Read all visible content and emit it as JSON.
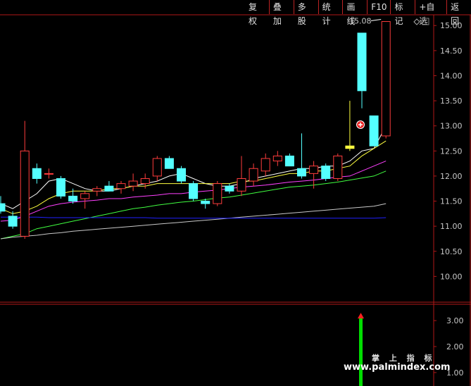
{
  "toolbar": {
    "buttons": [
      "复权",
      "叠加",
      "多股",
      "统计",
      "画线",
      "F10",
      "标记",
      "+自选",
      "返回"
    ]
  },
  "colors": {
    "up": "#ff3c3c",
    "down": "#54ffff",
    "panel_border": "#b01818",
    "ma5": "#ffffff",
    "ma10": "#ffff40",
    "ma20": "#ff40ff",
    "ma30": "#40ff40",
    "ma60": "#c8c8c8",
    "blue": "#2020ff",
    "signal": "#00dd00"
  },
  "chart_data": {
    "type": "candlestick",
    "price_axis": {
      "min": 9.5,
      "max": 15.2,
      "ticks": [
        "15.00",
        "14.50",
        "14.00",
        "13.50",
        "13.00",
        "12.50",
        "12.00",
        "11.50",
        "11.00",
        "10.50",
        "10.00"
      ]
    },
    "candles": [
      {
        "o": 11.45,
        "h": 11.6,
        "l": 11.25,
        "c": 11.3
      },
      {
        "o": 11.2,
        "h": 11.3,
        "l": 10.95,
        "c": 11.0
      },
      {
        "o": 10.8,
        "h": 13.1,
        "l": 10.75,
        "c": 12.5
      },
      {
        "o": 12.15,
        "h": 12.25,
        "l": 11.85,
        "c": 11.95
      },
      {
        "o": 12.05,
        "h": 12.15,
        "l": 11.95,
        "c": 12.05
      },
      {
        "o": 11.95,
        "h": 12.0,
        "l": 11.55,
        "c": 11.6
      },
      {
        "o": 11.6,
        "h": 11.75,
        "l": 11.45,
        "c": 11.5
      },
      {
        "o": 11.55,
        "h": 11.7,
        "l": 11.35,
        "c": 11.65
      },
      {
        "o": 11.7,
        "h": 11.8,
        "l": 11.6,
        "c": 11.75
      },
      {
        "o": 11.8,
        "h": 11.9,
        "l": 11.7,
        "c": 11.7
      },
      {
        "o": 11.75,
        "h": 11.9,
        "l": 11.65,
        "c": 11.85
      },
      {
        "o": 11.8,
        "h": 12.05,
        "l": 11.7,
        "c": 11.9
      },
      {
        "o": 11.85,
        "h": 12.05,
        "l": 11.75,
        "c": 11.95
      },
      {
        "o": 12.0,
        "h": 12.4,
        "l": 11.9,
        "c": 12.35
      },
      {
        "o": 12.35,
        "h": 12.4,
        "l": 12.15,
        "c": 12.15
      },
      {
        "o": 12.15,
        "h": 12.2,
        "l": 11.85,
        "c": 11.9
      },
      {
        "o": 11.85,
        "h": 11.9,
        "l": 11.5,
        "c": 11.55
      },
      {
        "o": 11.5,
        "h": 11.55,
        "l": 11.35,
        "c": 11.45
      },
      {
        "o": 11.45,
        "h": 11.9,
        "l": 11.4,
        "c": 11.85
      },
      {
        "o": 11.8,
        "h": 11.85,
        "l": 11.65,
        "c": 11.7
      },
      {
        "o": 11.7,
        "h": 12.4,
        "l": 11.6,
        "c": 11.95
      },
      {
        "o": 11.9,
        "h": 12.25,
        "l": 11.8,
        "c": 12.15
      },
      {
        "o": 12.1,
        "h": 12.45,
        "l": 12.0,
        "c": 12.35
      },
      {
        "o": 12.3,
        "h": 12.5,
        "l": 12.2,
        "c": 12.4
      },
      {
        "o": 12.4,
        "h": 12.45,
        "l": 12.2,
        "c": 12.2
      },
      {
        "o": 12.15,
        "h": 12.85,
        "l": 11.95,
        "c": 12.0
      },
      {
        "o": 12.05,
        "h": 12.3,
        "l": 11.75,
        "c": 12.2
      },
      {
        "o": 12.2,
        "h": 12.25,
        "l": 11.9,
        "c": 11.95
      },
      {
        "o": 11.95,
        "h": 12.45,
        "l": 11.9,
        "c": 12.4
      },
      {
        "o": 12.55,
        "h": 13.5,
        "l": 12.5,
        "c": 12.6
      },
      {
        "o": 14.85,
        "h": 14.85,
        "l": 13.35,
        "c": 13.7
      },
      {
        "o": 13.2,
        "h": 13.2,
        "l": 12.6,
        "c": 12.6
      },
      {
        "o": 12.8,
        "h": 15.08,
        "l": 12.75,
        "c": 15.08
      }
    ],
    "candle_color_override": {
      "29": "#ffff40"
    },
    "high_label": "15.08",
    "ma_lines": {
      "ma5": [
        11.45,
        11.35,
        11.5,
        11.65,
        11.9,
        11.95,
        11.85,
        11.75,
        11.7,
        11.7,
        11.75,
        11.8,
        11.85,
        11.9,
        12.0,
        12.05,
        11.95,
        11.85,
        11.8,
        11.8,
        11.85,
        11.95,
        12.0,
        12.05,
        12.1,
        12.15,
        12.15,
        12.2,
        12.2,
        12.3,
        12.5,
        12.55,
        13.0
      ],
      "ma10": [
        11.35,
        11.25,
        11.3,
        11.4,
        11.55,
        11.65,
        11.7,
        11.7,
        11.7,
        11.75,
        11.75,
        11.8,
        11.8,
        11.85,
        11.85,
        11.85,
        11.85,
        11.85,
        11.85,
        11.85,
        11.9,
        11.9,
        11.95,
        12.0,
        12.05,
        12.05,
        12.1,
        12.1,
        12.15,
        12.2,
        12.4,
        12.55,
        12.7
      ],
      "ma20": [
        11.1,
        11.12,
        11.2,
        11.3,
        11.4,
        11.45,
        11.48,
        11.5,
        11.52,
        11.55,
        11.55,
        11.58,
        11.6,
        11.62,
        11.65,
        11.65,
        11.68,
        11.7,
        11.72,
        11.75,
        11.78,
        11.8,
        11.82,
        11.85,
        11.88,
        11.9,
        11.92,
        11.95,
        11.98,
        12.0,
        12.1,
        12.2,
        12.3
      ],
      "ma30": [
        10.75,
        10.8,
        10.85,
        10.95,
        11.0,
        11.05,
        11.1,
        11.15,
        11.2,
        11.25,
        11.3,
        11.35,
        11.38,
        11.42,
        11.45,
        11.48,
        11.5,
        11.53,
        11.56,
        11.58,
        11.62,
        11.66,
        11.7,
        11.74,
        11.78,
        11.8,
        11.82,
        11.85,
        11.88,
        11.92,
        11.96,
        12.0,
        12.1
      ],
      "ma60": [
        10.75,
        10.78,
        10.8,
        10.82,
        10.85,
        10.87,
        10.9,
        10.92,
        10.94,
        10.96,
        10.98,
        11.0,
        11.02,
        11.04,
        11.06,
        11.08,
        11.1,
        11.12,
        11.14,
        11.16,
        11.18,
        11.2,
        11.22,
        11.24,
        11.26,
        11.28,
        11.3,
        11.32,
        11.34,
        11.36,
        11.38,
        11.4,
        11.45
      ],
      "blue": [
        11.18,
        11.18,
        11.18,
        11.18,
        11.17,
        11.17,
        11.17,
        11.17,
        11.17,
        11.17,
        11.17,
        11.17,
        11.17,
        11.16,
        11.16,
        11.16,
        11.16,
        11.16,
        11.16,
        11.16,
        11.16,
        11.16,
        11.16,
        11.16,
        11.16,
        11.16,
        11.16,
        11.16,
        11.16,
        11.16,
        11.16,
        11.16,
        11.17
      ]
    },
    "indicator": {
      "ticks": [
        "3.00",
        "2.00",
        "1.00"
      ],
      "value": 3.3
    }
  },
  "watermark": {
    "title": "掌 上 指 标",
    "url": "www.palmindex.com"
  }
}
